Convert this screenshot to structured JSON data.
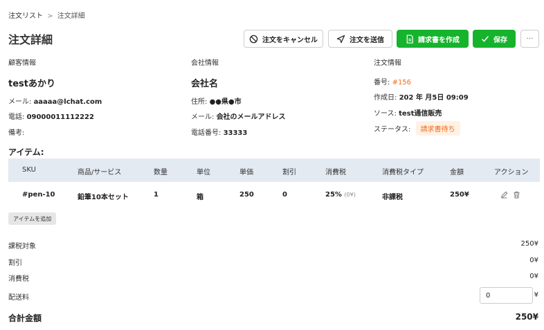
{
  "breadcrumb": {
    "parent": "注文リスト",
    "separator": ">",
    "current": "注文詳細"
  },
  "page_title": "注文詳細",
  "actions": {
    "cancel": "注文をキャンセル",
    "send": "注文を送信",
    "invoice": "請求書を作成",
    "save": "保存",
    "more": "···"
  },
  "customer": {
    "heading": "顧客情報",
    "name": "testあかり",
    "email_label": "メール:",
    "email": "aaaaa@lchat.com",
    "phone_label": "電話:",
    "phone": "09000011112222",
    "note_label": "備考:",
    "note": ""
  },
  "company": {
    "heading": "会社情報",
    "name": "会社名",
    "address_label": "住所:",
    "address": "●●県●市",
    "email_label": "メール:",
    "email": "会社のメールアドレス",
    "phone_label": "電話番号:",
    "phone": "33333"
  },
  "order": {
    "heading": "注文情報",
    "number_label": "番号:",
    "number": "#156",
    "created_label": "作成日:",
    "created": "202 年 月5日 09:09",
    "source_label": "ソース:",
    "source": "test通信販売",
    "status_label": "ステータス:",
    "status": "請求書待ち"
  },
  "items": {
    "label": "アイテム:",
    "columns": [
      "SKU",
      "商品/サービス",
      "数量",
      "単位",
      "単価",
      "割引",
      "消費税",
      "消費税タイプ",
      "金額",
      "アクション"
    ],
    "rows": [
      {
        "sku": "#pen-10",
        "product": "鉛筆10本セット",
        "qty": "1",
        "unit": "箱",
        "price": "250",
        "discount": "0",
        "tax": "25%",
        "tax_amount": "(0¥)",
        "tax_type": "非課税",
        "amount": "250¥"
      }
    ],
    "add_label": "アイテムを追加"
  },
  "summary": {
    "taxable_label": "課税対象",
    "taxable": "250¥",
    "discount_label": "割引",
    "discount": "0¥",
    "tax_label": "消費税",
    "tax": "0¥",
    "shipping_label": "配送料",
    "shipping": "0",
    "shipping_unit": "¥",
    "total_label": "合計金額",
    "total": "250¥"
  },
  "colors": {
    "accent_green": "#16b32c",
    "accent_orange": "#f26b1d",
    "table_header_bg": "#e4eaf2"
  }
}
